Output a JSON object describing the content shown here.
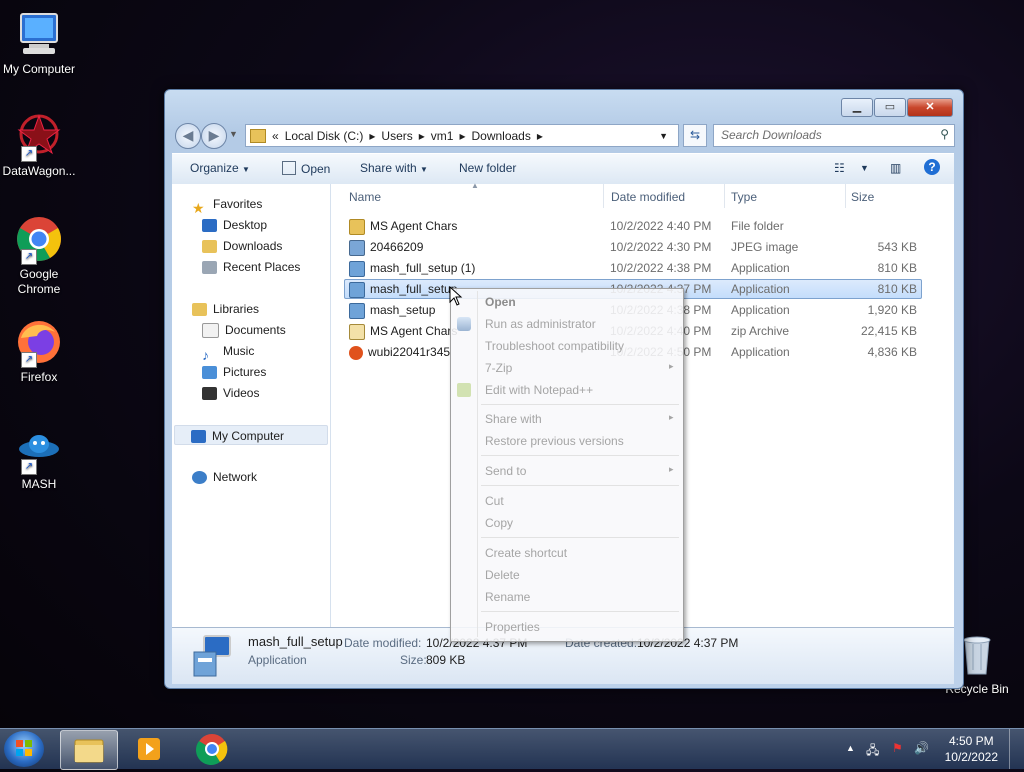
{
  "desktop": {
    "icons": [
      {
        "label": "My Computer"
      },
      {
        "label": "DataWagon..."
      },
      {
        "label": "Google Chrome"
      },
      {
        "label": "Firefox"
      },
      {
        "label": "MASH"
      },
      {
        "label": "Recycle Bin"
      }
    ]
  },
  "window": {
    "breadcrumb": {
      "prefix": "«",
      "parts": [
        "Local Disk (C:)",
        "Users",
        "vm1",
        "Downloads"
      ]
    },
    "search_placeholder": "Search Downloads",
    "toolbar": {
      "organize": "Organize",
      "open": "Open",
      "share_with": "Share with",
      "new_folder": "New folder"
    },
    "nav": {
      "favorites": "Favorites",
      "desktop": "Desktop",
      "downloads": "Downloads",
      "recent_places": "Recent Places",
      "libraries": "Libraries",
      "documents": "Documents",
      "music": "Music",
      "pictures": "Pictures",
      "videos": "Videos",
      "my_computer": "My Computer",
      "network": "Network"
    },
    "columns": {
      "name": "Name",
      "date_modified": "Date modified",
      "type": "Type",
      "size": "Size"
    },
    "files": [
      {
        "name": "MS Agent Chars",
        "date": "10/2/2022 4:40 PM",
        "type": "File folder",
        "size": "",
        "icon": "folder-icon"
      },
      {
        "name": "20466209",
        "date": "10/2/2022 4:30 PM",
        "type": "JPEG image",
        "size": "543 KB",
        "icon": "image-icon"
      },
      {
        "name": "mash_full_setup (1)",
        "date": "10/2/2022 4:38 PM",
        "type": "Application",
        "size": "810 KB",
        "icon": "installer-icon"
      },
      {
        "name": "mash_full_setup",
        "date": "10/2/2022 4:37 PM",
        "type": "Application",
        "size": "810 KB",
        "icon": "installer-icon"
      },
      {
        "name": "mash_setup",
        "date": "10/2/2022 4:38 PM",
        "type": "Application",
        "size": "1,920 KB",
        "icon": "installer-icon"
      },
      {
        "name": "MS Agent Chars",
        "date": "10/2/2022 4:40 PM",
        "type": "zip Archive",
        "size": "22,415 KB",
        "icon": "zip-icon"
      },
      {
        "name": "wubi22041r345",
        "date": "10/2/2022 4:50 PM",
        "type": "Application",
        "size": "4,836 KB",
        "icon": "ubuntu-icon"
      }
    ],
    "details": {
      "name": "mash_full_setup",
      "type": "Application",
      "date_modified_label": "Date modified:",
      "date_modified": "10/2/2022 4:37 PM",
      "date_created_label": "Date created:",
      "date_created": "10/2/2022 4:37 PM",
      "size_label": "Size:",
      "size": "809 KB"
    }
  },
  "context_menu": {
    "items": [
      {
        "label": "Open"
      },
      {
        "label": "Run as administrator"
      },
      {
        "label": "Troubleshoot compatibility"
      },
      {
        "label": "7-Zip"
      },
      {
        "label": "Edit with Notepad++"
      },
      {
        "label": "Share with"
      },
      {
        "label": "Restore previous versions"
      },
      {
        "label": "Send to"
      },
      {
        "label": "Cut"
      },
      {
        "label": "Copy"
      },
      {
        "label": "Create shortcut"
      },
      {
        "label": "Delete"
      },
      {
        "label": "Rename"
      },
      {
        "label": "Properties"
      }
    ],
    "submenu_arrow": "▸"
  },
  "taskbar": {
    "time": "4:50 PM",
    "date": "10/2/2022"
  },
  "colors": {
    "selection": "#c4ddfb",
    "accent": "#1e395b"
  }
}
